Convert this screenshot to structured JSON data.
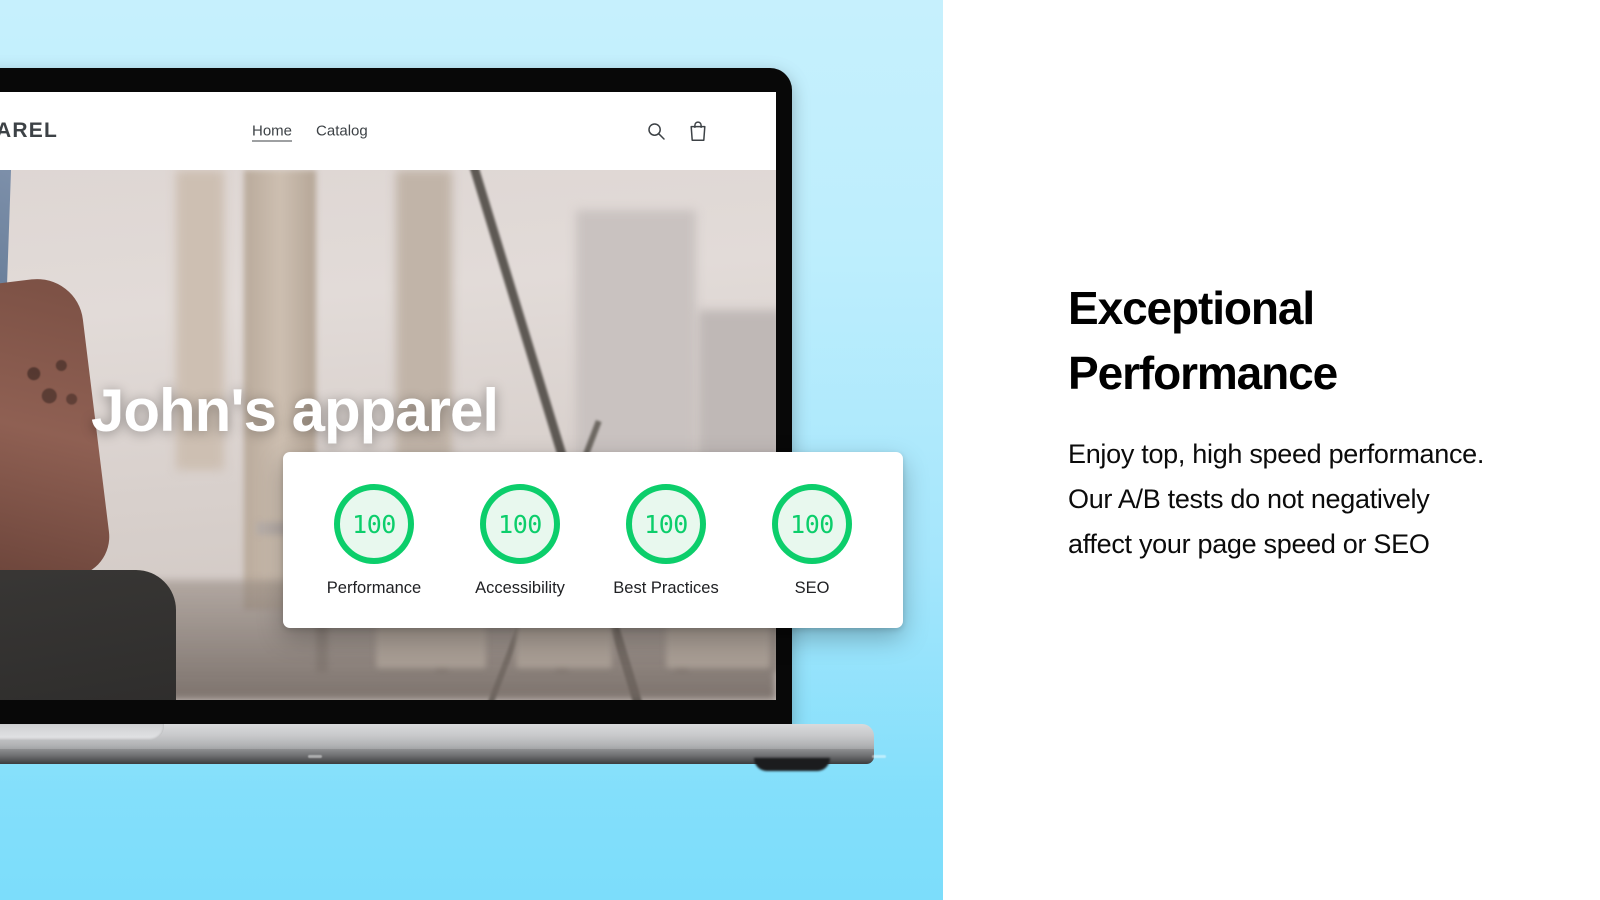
{
  "colors": {
    "panel_blue_top": "#c6f0fd",
    "panel_blue_bottom": "#7cddfb",
    "gauge_green": "#0cce6b",
    "gauge_fill": "#e8f8ee",
    "text_black": "#000000",
    "card_white": "#ffffff"
  },
  "storefront": {
    "logo": "AREL",
    "nav": [
      {
        "label": "Home",
        "active": true
      },
      {
        "label": "Catalog",
        "active": false
      }
    ],
    "icons": [
      {
        "name": "search-icon",
        "label": "Search"
      },
      {
        "name": "shopping-bag-icon",
        "label": "Cart"
      }
    ],
    "hero_title": "John's apparel"
  },
  "lighthouse": {
    "scores": [
      {
        "value": "100",
        "label": "Performance"
      },
      {
        "value": "100",
        "label": "Accessibility"
      },
      {
        "value": "100",
        "label": "Best Practices"
      },
      {
        "value": "100",
        "label": "SEO"
      }
    ]
  },
  "feature": {
    "title_line1": "Exceptional",
    "title_line2": "Performance",
    "body": "Enjoy top, high speed performance.  Our A/B tests do not negatively affect your page speed or SEO"
  }
}
